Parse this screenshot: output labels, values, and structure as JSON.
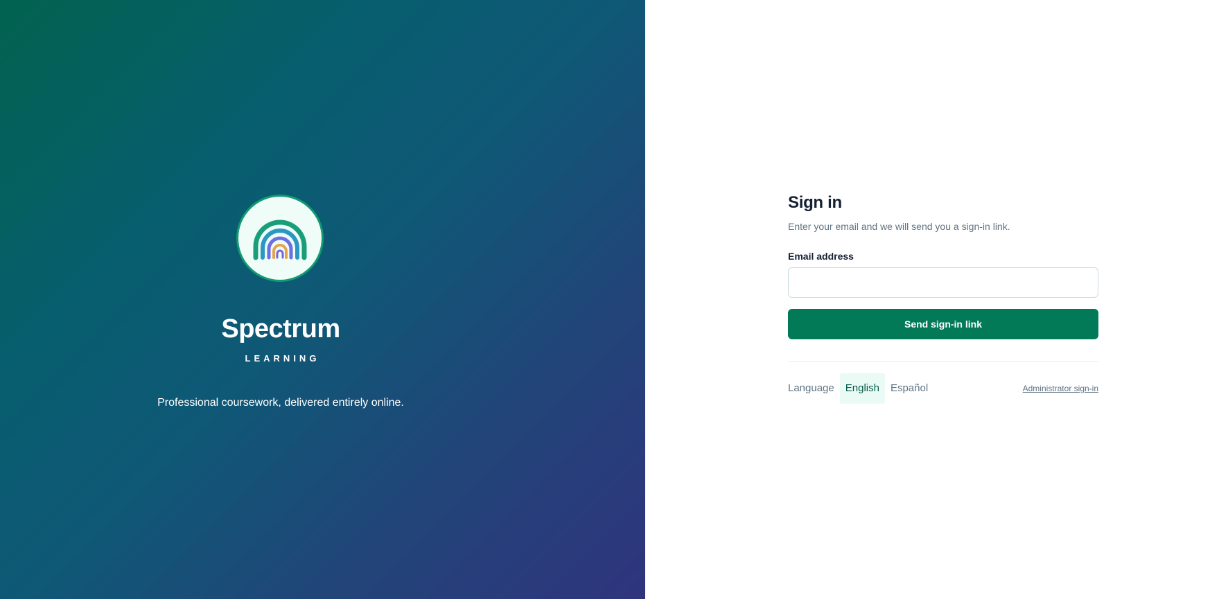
{
  "brand": {
    "name": "Spectrum",
    "subtitle": "LEARNING",
    "tagline": "Professional coursework, delivered entirely online."
  },
  "signin": {
    "title": "Sign in",
    "subtitle": "Enter your email and we will send you a sign-in link.",
    "email_label": "Email address",
    "email_value": "",
    "email_placeholder": "",
    "submit_label": "Send sign-in link"
  },
  "footer": {
    "language_label": "Language",
    "languages": [
      {
        "label": "English",
        "selected": true
      },
      {
        "label": "Español",
        "selected": false
      }
    ],
    "admin_link": "Administrator sign-in"
  },
  "colors": {
    "brand_gradient_start": "#02624f",
    "brand_gradient_end": "#2f347d",
    "primary_button": "#027a58",
    "logo_border": "#139a72"
  },
  "icons": {
    "logo": "rainbow-arch-icon"
  }
}
